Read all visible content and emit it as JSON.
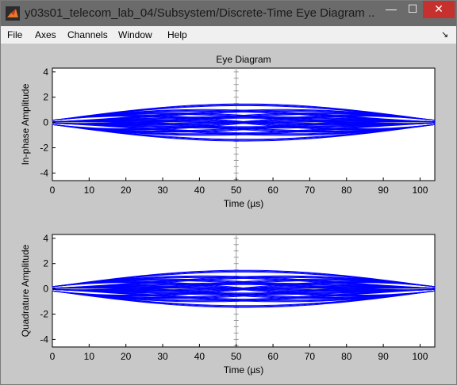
{
  "window": {
    "title": "y03s01_telecom_lab_04/Subsystem/Discrete-Time Eye Diagram ...",
    "minimize_glyph": "—",
    "maximize_glyph": "☐",
    "close_glyph": "✕"
  },
  "menu": {
    "items": [
      "File",
      "Axes",
      "Channels",
      "Window",
      "Help"
    ],
    "dock_glyph": "↘"
  },
  "colors": {
    "trace": "#0000ff",
    "titlebar": "#6b6b6b",
    "close": "#c7312d"
  },
  "chart_data": [
    {
      "type": "line",
      "title": "Eye Diagram",
      "xlabel": "Time (µs)",
      "ylabel": "In-phase Amplitude",
      "xlim": [
        0,
        104
      ],
      "ylim": [
        -4.6,
        4.3
      ],
      "xticks": [
        0,
        10,
        20,
        30,
        40,
        50,
        60,
        70,
        80,
        90,
        100
      ],
      "yticks": [
        -4,
        -2,
        0,
        2,
        4
      ],
      "levels": [
        -1.4,
        -0.4,
        0.4,
        1.4
      ],
      "crossover_at": [
        0,
        104
      ],
      "grid": true
    },
    {
      "type": "line",
      "title": "",
      "xlabel": "Time (µs)",
      "ylabel": "Quadrature Amplitude",
      "xlim": [
        0,
        104
      ],
      "ylim": [
        -4.6,
        4.3
      ],
      "xticks": [
        0,
        10,
        20,
        30,
        40,
        50,
        60,
        70,
        80,
        90,
        100
      ],
      "yticks": [
        -4,
        -2,
        0,
        2,
        4
      ],
      "levels": [
        -1.4,
        -0.4,
        0.4,
        1.4
      ],
      "crossover_at": [
        0,
        104
      ],
      "grid": true
    }
  ]
}
